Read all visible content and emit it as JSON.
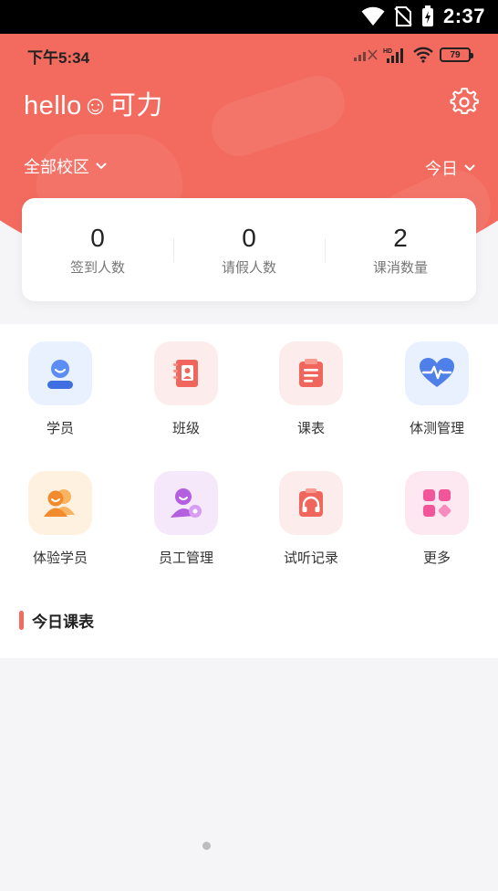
{
  "system_status": {
    "time": "2:37"
  },
  "app_status": {
    "time": "下午5:34",
    "battery": "79"
  },
  "header": {
    "greeting": "hello☺可力",
    "campus_selector": "全部校区",
    "date_selector": "今日"
  },
  "stats": [
    {
      "value": "0",
      "label": "签到人数"
    },
    {
      "value": "0",
      "label": "请假人数"
    },
    {
      "value": "2",
      "label": "课消数量"
    }
  ],
  "grid": [
    {
      "label": "学员",
      "icon": "student-icon"
    },
    {
      "label": "班级",
      "icon": "class-book-icon"
    },
    {
      "label": "课表",
      "icon": "timetable-icon"
    },
    {
      "label": "体测管理",
      "icon": "fitness-test-icon"
    },
    {
      "label": "体验学员",
      "icon": "trial-student-icon"
    },
    {
      "label": "员工管理",
      "icon": "staff-icon"
    },
    {
      "label": "试听记录",
      "icon": "audition-record-icon"
    },
    {
      "label": "更多",
      "icon": "more-icon"
    }
  ],
  "schedule": {
    "title": "今日课表"
  },
  "colors": {
    "brand": "#f36b5f",
    "background": "#f5f5f7"
  }
}
